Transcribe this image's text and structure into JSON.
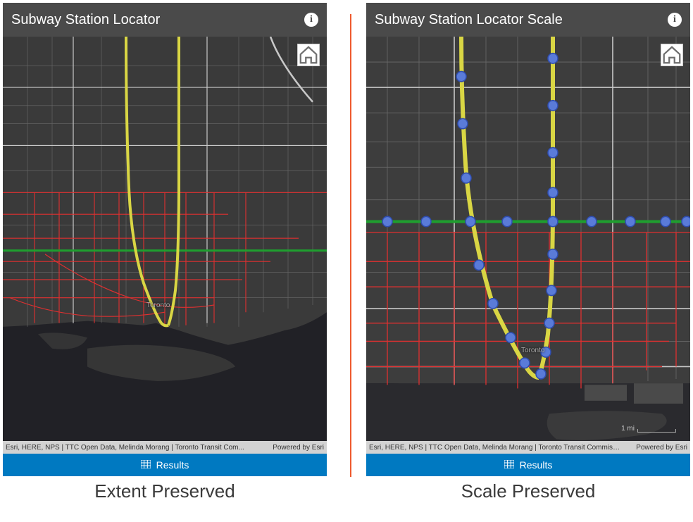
{
  "left": {
    "header_title": "Subway Station Locator",
    "attribution": "Esri, HERE, NPS | TTC Open Data, Melinda Morang | Toronto Transit Com...",
    "powered": "Powered by Esri",
    "results_label": "Results",
    "caption": "Extent Preserved",
    "city_label": "Toronto"
  },
  "right": {
    "header_title": "Subway Station Locator Scale",
    "attribution": "Esri, HERE, NPS | TTC Open Data, Melinda Morang | Toronto Transit Commissio...",
    "powered": "Powered by Esri",
    "results_label": "Results",
    "caption": "Scale Preserved",
    "city_label": "Toronto",
    "scale_label": "1 mi"
  },
  "colors": {
    "subway_line": "#d9d644",
    "green_line": "#1f9e2f",
    "bus_route": "#e03030",
    "station": "#5a7bd8",
    "station_stroke": "#2f4db0",
    "road_major": "#c8c8c8",
    "road_minor": "#6a6a6a",
    "water": "#212126",
    "land": "#3a3a3a"
  }
}
